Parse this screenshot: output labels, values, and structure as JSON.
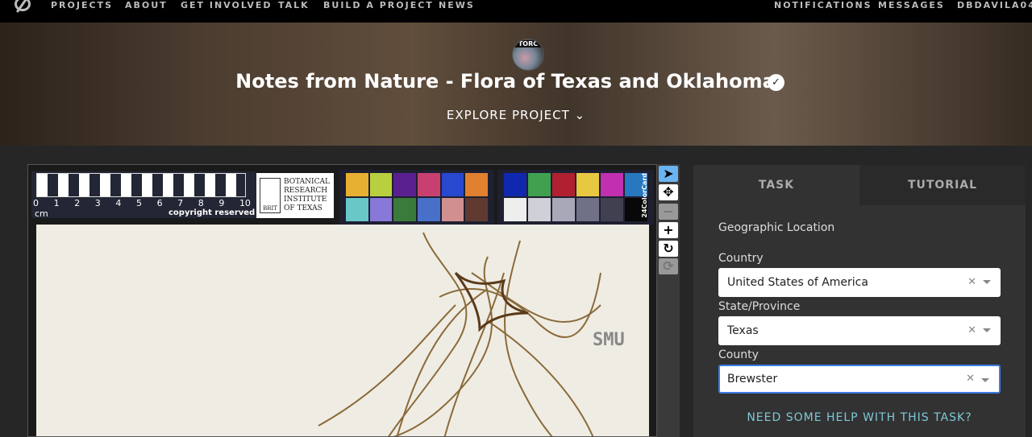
{
  "nav": {
    "left": [
      "PROJECTS",
      "ABOUT",
      "GET INVOLVED",
      "TALK",
      "BUILD A PROJECT",
      "NEWS"
    ],
    "right": [
      "NOTIFICATIONS",
      "MESSAGES",
      "DBDAVILA04"
    ]
  },
  "project": {
    "title": "Notes from Nature - Flora of Texas and Oklahoma",
    "explore": "EXPLORE PROJECT",
    "avatar_text": "TORC"
  },
  "specimen": {
    "ruler_numbers": [
      "0",
      "1",
      "2",
      "3",
      "4",
      "5",
      "6",
      "7",
      "8",
      "9",
      "10"
    ],
    "ruler_unit": "cm",
    "copyright": "copyright reserved",
    "institution": "BOTANICAL RESEARCH INSTITUTE OF TEXAS",
    "inst_abbr": "BRIT",
    "colorcard": "24ColorCard",
    "stamp": "SMU"
  },
  "task_panel": {
    "tabs": [
      "TASK",
      "TUTORIAL"
    ],
    "section": "Geographic Location",
    "fields": [
      {
        "label": "Country",
        "value": "United States of America"
      },
      {
        "label": "State/Province",
        "value": "Texas"
      },
      {
        "label": "County",
        "value": "Brewster"
      }
    ],
    "help": "NEED SOME HELP WITH THIS TASK?"
  }
}
